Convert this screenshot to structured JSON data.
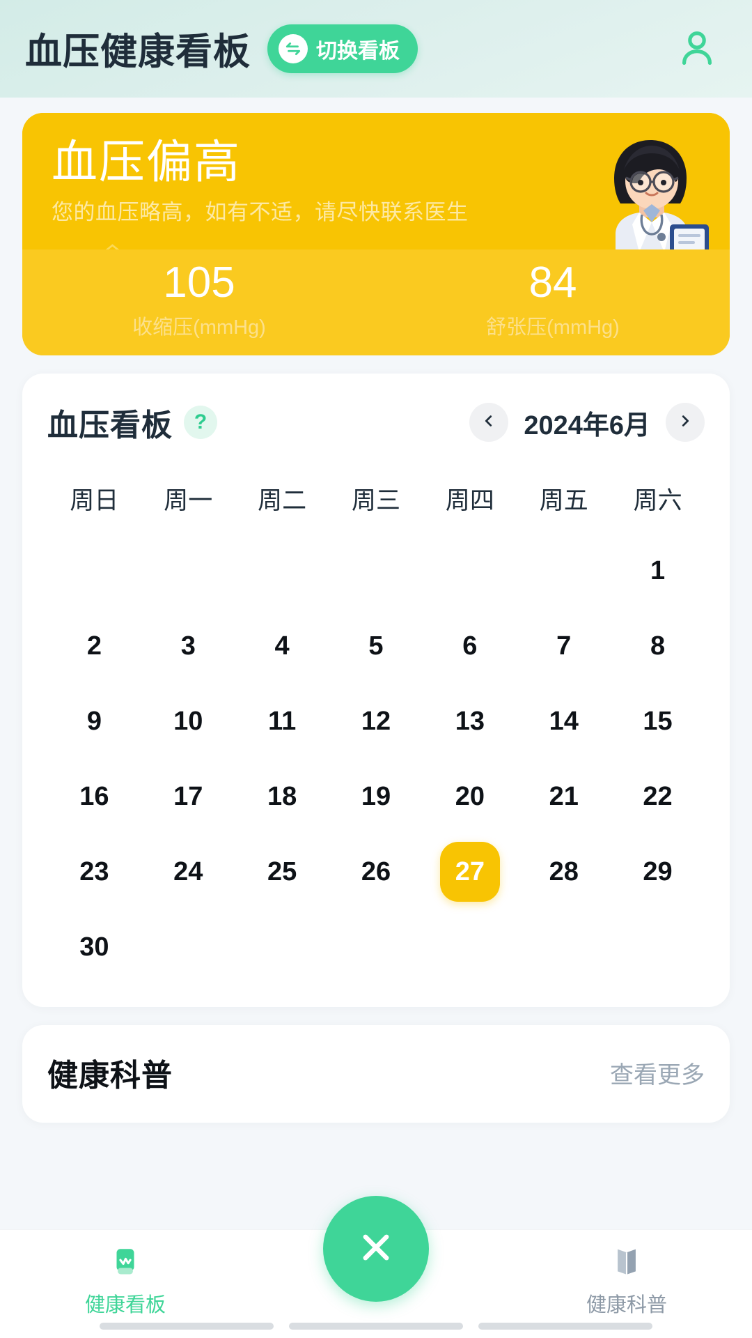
{
  "header": {
    "title": "血压健康看板",
    "switch_label": "切换看板",
    "switch_icon": "switch-dashboard-icon",
    "profile_icon": "user-avatar-icon",
    "accent_green": "#3FD598",
    "background": "#D5EDE8"
  },
  "status_card": {
    "title": "血压偏高",
    "subtitle": "您的血压略高，如有不适，请尽快联系医生",
    "background": "#F8C403",
    "illustration": "doctor-illustration",
    "readings": [
      {
        "value": "105",
        "label": "收缩压(mmHg)"
      },
      {
        "value": "84",
        "label": "舒张压(mmHg)"
      }
    ]
  },
  "calendar": {
    "title": "血压看板",
    "help_label": "?",
    "help_icon": "question-mark-icon",
    "prev_icon": "chevron-left-icon",
    "next_icon": "chevron-right-icon",
    "month_label": "2024年6月",
    "weekdays": [
      "周日",
      "周一",
      "周二",
      "周三",
      "周四",
      "周五",
      "周六"
    ],
    "leading_blanks": 6,
    "days": [
      1,
      2,
      3,
      4,
      5,
      6,
      7,
      8,
      9,
      10,
      11,
      12,
      13,
      14,
      15,
      16,
      17,
      18,
      19,
      20,
      21,
      22,
      23,
      24,
      25,
      26,
      27,
      28,
      29,
      30
    ],
    "selected_day": 27,
    "selected_color": "#F8C403"
  },
  "science_card": {
    "title": "健康科普",
    "more_label": "查看更多"
  },
  "tabbar": {
    "items": [
      {
        "label": "健康看板",
        "icon": "health-dashboard-icon",
        "active": true
      },
      {
        "label": "健康科普",
        "icon": "book-icon",
        "active": false
      }
    ],
    "fab_icon": "close-x-icon",
    "fab_color": "#3FD598"
  }
}
